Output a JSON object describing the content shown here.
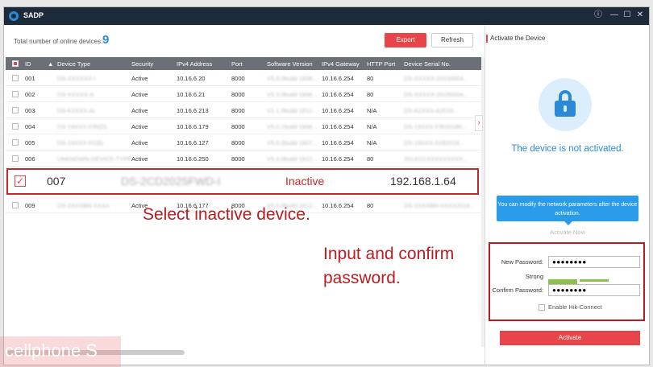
{
  "window": {
    "title": "SADP",
    "controls": [
      "ⓘ",
      "—",
      "☐",
      "✕"
    ]
  },
  "toolbar": {
    "total_label": "Total number of online devices:",
    "total_count": "9",
    "export_label": "Export",
    "refresh_label": "Refresh"
  },
  "table": {
    "headers": [
      "ID",
      "Device Type",
      "Security",
      "IPv4 Address",
      "Port",
      "Software Version",
      "IPv4 Gateway",
      "HTTP Port",
      "Device Serial No."
    ],
    "rows": [
      {
        "id": "001",
        "type": "DS-XXXXXX-I",
        "security": "Active",
        "ip": "10.16.6.20",
        "port": "8000",
        "sw": "V5.3.0build 1808...",
        "gw": "10.16.6.254",
        "http": "80",
        "serial": "DS-XXXXX-20150004..."
      },
      {
        "id": "002",
        "type": "DS-XXXXX-A",
        "security": "Active",
        "ip": "10.16.6.21",
        "port": "8000",
        "sw": "V5.3.0build 1808...",
        "gw": "10.16.6.254",
        "http": "80",
        "serial": "DS-XXXXX-20150004..."
      },
      {
        "id": "003",
        "type": "DS-K2XXX-AI",
        "security": "Active",
        "ip": "10.16.6.213",
        "port": "8000",
        "sw": "V1.1.0build 1812...",
        "gw": "10.16.6.254",
        "http": "N/A",
        "serial": "DS-K2XXX-A2018..."
      },
      {
        "id": "004",
        "type": "DS-19XXX-F/R(D)",
        "security": "Active",
        "ip": "10.16.6.179",
        "port": "8000",
        "sw": "V5.0.1build 1808...",
        "gw": "10.16.6.254",
        "http": "N/A",
        "serial": "DS-19XXX-F/R20180..."
      },
      {
        "id": "005",
        "type": "DS-19XXX-01(B)",
        "security": "Active",
        "ip": "10.16.6.127",
        "port": "8000",
        "sw": "V5.0.2build 1807...",
        "gw": "10.16.6.254",
        "http": "N/A",
        "serial": "DS-19XXX-01B2018..."
      },
      {
        "id": "006",
        "type": "UNKNOWN-DEVICE-TYPE",
        "security": "Active",
        "ip": "10.16.6.250",
        "port": "8000",
        "sw": "V5.4.0build 1812...",
        "gw": "10.16.6.254",
        "http": "80",
        "serial": "2014111XXXXXXXXX..."
      },
      {
        "id": "009",
        "type": "DS-2XXXBN-XXXX",
        "security": "Active",
        "ip": "10.16.6.177",
        "port": "8000",
        "sw": "V5.5.0build 1812...",
        "gw": "10.16.6.254",
        "http": "80",
        "serial": "DS-2XXXBN-XXXX2018..."
      }
    ],
    "highlight": {
      "id": "007",
      "type": "DS-2CD2025FWD-I",
      "security": "Inactive",
      "ip": "192.168.1.64",
      "check": "✓"
    }
  },
  "annotations": {
    "select": "Select inactive device.",
    "input_line1": "Input and confirm",
    "input_line2": "password."
  },
  "panel": {
    "header": "Activate the Device",
    "status": "The device is not activated.",
    "tip": "You can modify the network parameters after the device activation.",
    "activate_now": "Activate Now",
    "new_pw_label": "New Password:",
    "new_pw_value": "●●●●●●●●",
    "strength_label": "Strong",
    "confirm_label": "Confirm Password:",
    "confirm_value": "●●●●●●●●",
    "hik_connect": "Enable Hik-Connect",
    "activate_btn": "Activate"
  },
  "watermark": "cellphone S",
  "colors": {
    "accent_blue": "#2a8ad8",
    "accent_red": "#e8454a",
    "annotation_red": "#b81c22",
    "titlebar": "#1d2a3a"
  }
}
